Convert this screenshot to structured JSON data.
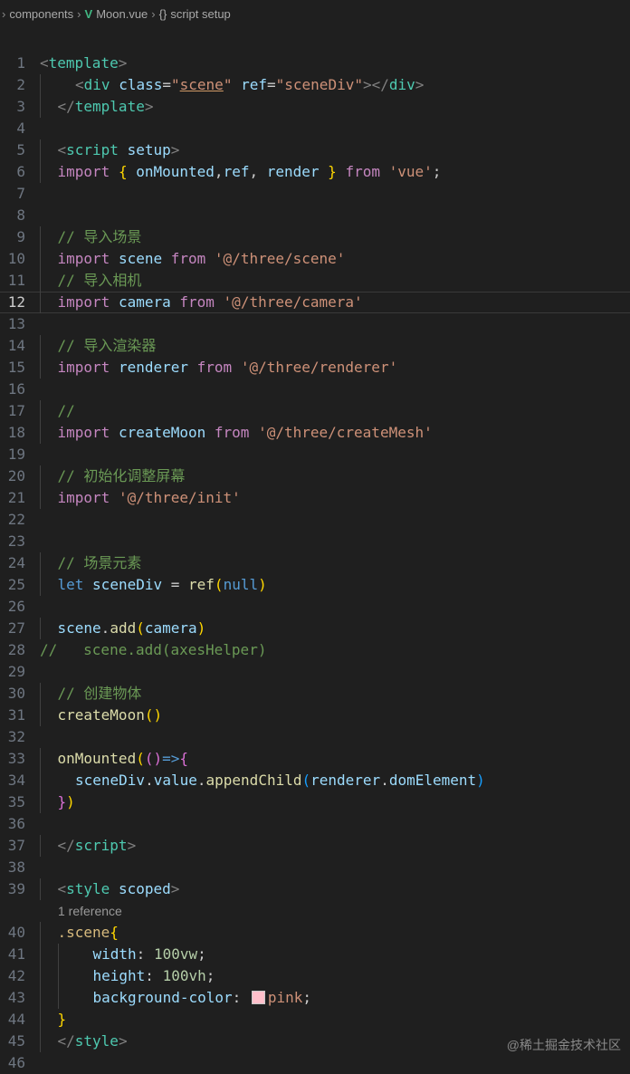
{
  "breadcrumbs": {
    "items": [
      "components",
      "Moon.vue",
      "script setup"
    ],
    "vue_icon": "V",
    "braces": "{}"
  },
  "editor": {
    "current_line": 12,
    "code_lens": "1 reference",
    "lines": [
      {
        "n": "1",
        "indent": 0,
        "tokens": [
          [
            "angle",
            "<"
          ],
          [
            "tag",
            "template"
          ],
          [
            "angle",
            ">"
          ]
        ]
      },
      {
        "n": "2",
        "indent": 2,
        "tokens": [
          [
            "angle",
            "<"
          ],
          [
            "tag",
            "div"
          ],
          [
            "plain",
            " "
          ],
          [
            "attr",
            "class"
          ],
          [
            "plain",
            "="
          ],
          [
            "str",
            "\""
          ],
          [
            "str under",
            "scene"
          ],
          [
            "str",
            "\""
          ],
          [
            "plain",
            " "
          ],
          [
            "attr",
            "ref"
          ],
          [
            "plain",
            "="
          ],
          [
            "str",
            "\"sceneDiv\""
          ],
          [
            "angle",
            "></"
          ],
          [
            "tag",
            "div"
          ],
          [
            "angle",
            ">"
          ]
        ]
      },
      {
        "n": "3",
        "indent": 1,
        "tokens": [
          [
            "angle",
            "</"
          ],
          [
            "tag",
            "template"
          ],
          [
            "angle",
            ">"
          ]
        ]
      },
      {
        "n": "4",
        "indent": 0,
        "tokens": []
      },
      {
        "n": "5",
        "indent": 1,
        "tokens": [
          [
            "angle",
            "<"
          ],
          [
            "tag",
            "script"
          ],
          [
            "plain",
            " "
          ],
          [
            "attr",
            "setup"
          ],
          [
            "angle",
            ">"
          ]
        ]
      },
      {
        "n": "6",
        "indent": 1,
        "tokens": [
          [
            "kw",
            "import"
          ],
          [
            "plain",
            " "
          ],
          [
            "b1",
            "{"
          ],
          [
            "plain",
            " "
          ],
          [
            "var",
            "onMounted"
          ],
          [
            "plain",
            ","
          ],
          [
            "var",
            "ref"
          ],
          [
            "plain",
            ", "
          ],
          [
            "var",
            "render"
          ],
          [
            "plain",
            " "
          ],
          [
            "b1",
            "}"
          ],
          [
            "plain",
            " "
          ],
          [
            "kw",
            "from"
          ],
          [
            "plain",
            " "
          ],
          [
            "str",
            "'vue'"
          ],
          [
            "plain",
            ";"
          ]
        ]
      },
      {
        "n": "7",
        "indent": 0,
        "tokens": []
      },
      {
        "n": "8",
        "indent": 0,
        "tokens": []
      },
      {
        "n": "9",
        "indent": 1,
        "tokens": [
          [
            "cmt",
            "// 导入场景"
          ]
        ]
      },
      {
        "n": "10",
        "indent": 1,
        "tokens": [
          [
            "kw",
            "import"
          ],
          [
            "plain",
            " "
          ],
          [
            "var",
            "scene"
          ],
          [
            "plain",
            " "
          ],
          [
            "kw",
            "from"
          ],
          [
            "plain",
            " "
          ],
          [
            "str",
            "'@/three/scene'"
          ]
        ]
      },
      {
        "n": "11",
        "indent": 1,
        "tokens": [
          [
            "cmt",
            "// 导入相机"
          ]
        ]
      },
      {
        "n": "12",
        "indent": 1,
        "tokens": [
          [
            "kw",
            "import"
          ],
          [
            "plain",
            " "
          ],
          [
            "var",
            "camera"
          ],
          [
            "plain",
            " "
          ],
          [
            "kw",
            "from"
          ],
          [
            "plain",
            " "
          ],
          [
            "str",
            "'@/three/camera'"
          ]
        ]
      },
      {
        "n": "13",
        "indent": 0,
        "tokens": []
      },
      {
        "n": "14",
        "indent": 1,
        "tokens": [
          [
            "cmt",
            "// 导入渲染器"
          ]
        ]
      },
      {
        "n": "15",
        "indent": 1,
        "tokens": [
          [
            "kw",
            "import"
          ],
          [
            "plain",
            " "
          ],
          [
            "var",
            "renderer"
          ],
          [
            "plain",
            " "
          ],
          [
            "kw",
            "from"
          ],
          [
            "plain",
            " "
          ],
          [
            "str",
            "'@/three/renderer'"
          ]
        ]
      },
      {
        "n": "16",
        "indent": 0,
        "tokens": []
      },
      {
        "n": "17",
        "indent": 1,
        "tokens": [
          [
            "cmt",
            "//"
          ]
        ]
      },
      {
        "n": "18",
        "indent": 1,
        "tokens": [
          [
            "kw",
            "import"
          ],
          [
            "plain",
            " "
          ],
          [
            "var",
            "createMoon"
          ],
          [
            "plain",
            " "
          ],
          [
            "kw",
            "from"
          ],
          [
            "plain",
            " "
          ],
          [
            "str",
            "'@/three/createMesh'"
          ]
        ]
      },
      {
        "n": "19",
        "indent": 0,
        "tokens": []
      },
      {
        "n": "20",
        "indent": 1,
        "tokens": [
          [
            "cmt",
            "// 初始化调整屏幕"
          ]
        ]
      },
      {
        "n": "21",
        "indent": 1,
        "tokens": [
          [
            "kw",
            "import"
          ],
          [
            "plain",
            " "
          ],
          [
            "str",
            "'@/three/init'"
          ]
        ]
      },
      {
        "n": "22",
        "indent": 0,
        "tokens": []
      },
      {
        "n": "23",
        "indent": 0,
        "tokens": []
      },
      {
        "n": "24",
        "indent": 1,
        "tokens": [
          [
            "cmt",
            "// 场景元素"
          ]
        ]
      },
      {
        "n": "25",
        "indent": 1,
        "tokens": [
          [
            "decl",
            "let"
          ],
          [
            "plain",
            " "
          ],
          [
            "var",
            "sceneDiv"
          ],
          [
            "plain",
            " = "
          ],
          [
            "fn",
            "ref"
          ],
          [
            "b1",
            "("
          ],
          [
            "decl",
            "null"
          ],
          [
            "b1",
            ")"
          ]
        ]
      },
      {
        "n": "26",
        "indent": 0,
        "tokens": []
      },
      {
        "n": "27",
        "indent": 1,
        "tokens": [
          [
            "var",
            "scene"
          ],
          [
            "plain",
            "."
          ],
          [
            "fn",
            "add"
          ],
          [
            "b1",
            "("
          ],
          [
            "var",
            "camera"
          ],
          [
            "b1",
            ")"
          ]
        ]
      },
      {
        "n": "28",
        "indent": 0,
        "tokens": [
          [
            "cmt",
            "//   scene.add(axesHelper)"
          ]
        ]
      },
      {
        "n": "29",
        "indent": 0,
        "tokens": []
      },
      {
        "n": "30",
        "indent": 1,
        "tokens": [
          [
            "cmt",
            "// 创建物体"
          ]
        ]
      },
      {
        "n": "31",
        "indent": 1,
        "tokens": [
          [
            "fn",
            "createMoon"
          ],
          [
            "b1",
            "()"
          ]
        ]
      },
      {
        "n": "32",
        "indent": 0,
        "tokens": []
      },
      {
        "n": "33",
        "indent": 1,
        "tokens": [
          [
            "fn",
            "onMounted"
          ],
          [
            "b1",
            "("
          ],
          [
            "b2",
            "()"
          ],
          [
            "decl",
            "=>"
          ],
          [
            "b2",
            "{"
          ]
        ]
      },
      {
        "n": "34",
        "indent": 2,
        "tokens": [
          [
            "var",
            "sceneDiv"
          ],
          [
            "plain",
            "."
          ],
          [
            "var",
            "value"
          ],
          [
            "plain",
            "."
          ],
          [
            "fn",
            "appendChild"
          ],
          [
            "b3",
            "("
          ],
          [
            "var",
            "renderer"
          ],
          [
            "plain",
            "."
          ],
          [
            "var",
            "domElement"
          ],
          [
            "b3",
            ")"
          ]
        ]
      },
      {
        "n": "35",
        "indent": 1,
        "tokens": [
          [
            "b2",
            "}"
          ],
          [
            "b1",
            ")"
          ]
        ]
      },
      {
        "n": "36",
        "indent": 0,
        "tokens": []
      },
      {
        "n": "37",
        "indent": 1,
        "tokens": [
          [
            "angle",
            "</"
          ],
          [
            "tag",
            "script"
          ],
          [
            "angle",
            ">"
          ]
        ]
      },
      {
        "n": "38",
        "indent": 0,
        "tokens": []
      },
      {
        "n": "39",
        "indent": 1,
        "tokens": [
          [
            "angle",
            "<"
          ],
          [
            "tag",
            "style"
          ],
          [
            "plain",
            " "
          ],
          [
            "attr",
            "scoped"
          ],
          [
            "angle",
            ">"
          ]
        ],
        "lens_after": true
      },
      {
        "n": "40",
        "indent": 1,
        "tokens": [
          [
            "sel",
            ".scene"
          ],
          [
            "b1",
            "{"
          ]
        ]
      },
      {
        "n": "41",
        "indent": 3,
        "tokens": [
          [
            "prop",
            "width"
          ],
          [
            "plain",
            ": "
          ],
          [
            "num",
            "100vw"
          ],
          [
            "plain",
            ";"
          ]
        ]
      },
      {
        "n": "42",
        "indent": 3,
        "tokens": [
          [
            "prop",
            "height"
          ],
          [
            "plain",
            ": "
          ],
          [
            "num",
            "100vh"
          ],
          [
            "plain",
            ";"
          ]
        ]
      },
      {
        "n": "43",
        "indent": 3,
        "tokens": [
          [
            "prop",
            "background-color"
          ],
          [
            "plain",
            ": "
          ],
          [
            "swatch",
            ""
          ],
          [
            "str",
            "pink"
          ],
          [
            "plain",
            ";"
          ]
        ]
      },
      {
        "n": "44",
        "indent": 1,
        "tokens": [
          [
            "b1",
            "}"
          ]
        ]
      },
      {
        "n": "45",
        "indent": 1,
        "tokens": [
          [
            "angle",
            "</"
          ],
          [
            "tag",
            "style"
          ],
          [
            "angle",
            ">"
          ]
        ]
      },
      {
        "n": "46",
        "indent": 0,
        "tokens": []
      }
    ]
  },
  "watermark": "@稀土掘金技术社区"
}
